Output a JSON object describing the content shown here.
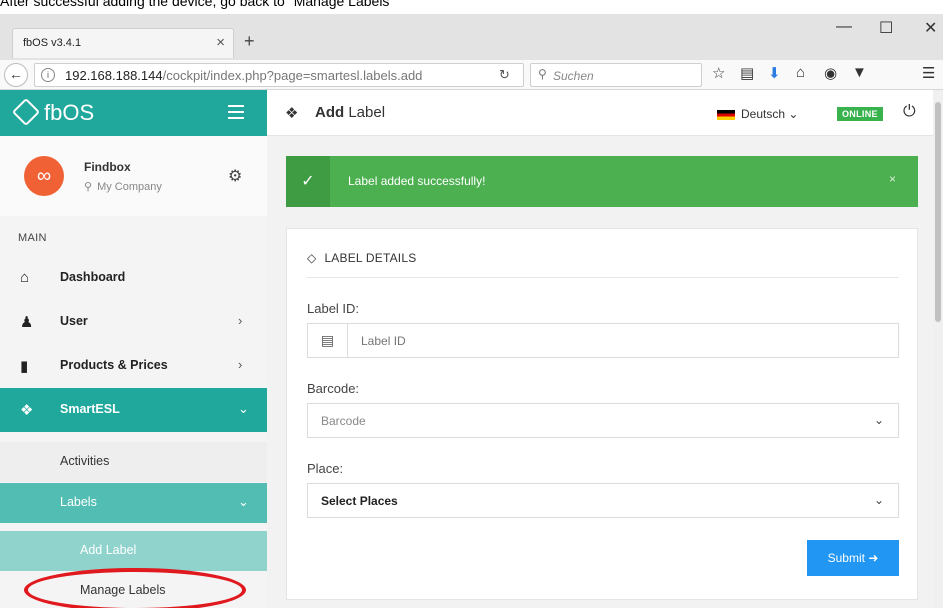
{
  "caption": "After successful adding the device, go back to \"Manage Labels\"",
  "browser": {
    "tab_title": "fbOS v3.4.1",
    "tab_close": "×",
    "new_tab": "+",
    "win_min": "—",
    "win_max": "☐",
    "win_close": "✕",
    "url_host": "192.168.188.144",
    "url_path": "/cockpit/index.php?page=smartesl.labels.add",
    "search_placeholder": "Suchen"
  },
  "sidebar": {
    "brand": "fbOS",
    "profile_name": "Findbox",
    "profile_company": "My Company",
    "avatar_glyph": "∞",
    "section": "MAIN",
    "items": [
      {
        "label": "Dashboard",
        "icon": "home-icon"
      },
      {
        "label": "User",
        "icon": "user-icon"
      },
      {
        "label": "Products & Prices",
        "icon": "book-icon"
      },
      {
        "label": "SmartESL",
        "icon": "tags-icon"
      }
    ],
    "sub_activities": "Activities",
    "sub_labels": "Labels",
    "sub_add": "Add Label",
    "sub_manage": "Manage Labels"
  },
  "header": {
    "title_bold": "Add",
    "title_rest": " Label",
    "language": "Deutsch",
    "status": "ONLINE"
  },
  "alert": {
    "message": "Label added successfully!",
    "close": "×"
  },
  "form": {
    "section_title": "LABEL DETAILS",
    "label_id_label": "Label ID:",
    "label_id_placeholder": "Label ID",
    "barcode_label": "Barcode:",
    "barcode_value": "Barcode",
    "place_label": "Place:",
    "place_value": "Select Places",
    "submit_label": "Submit"
  },
  "colors": {
    "brand": "#20a89d",
    "success": "#4caf50",
    "primary": "#2196f3",
    "annotation": "#e0191e"
  }
}
